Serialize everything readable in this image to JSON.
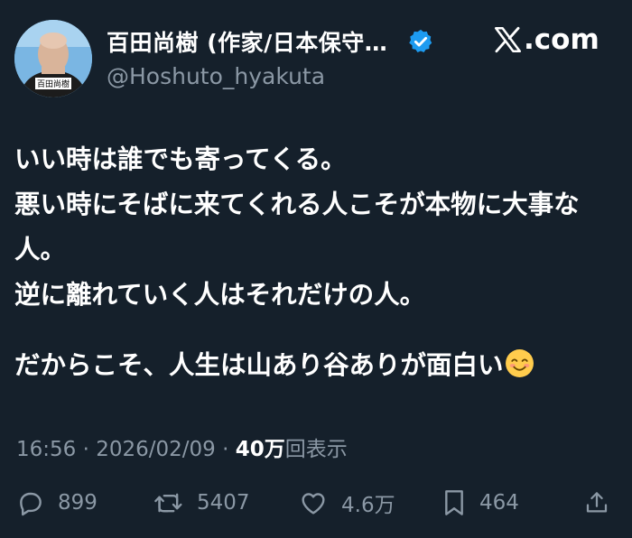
{
  "author": {
    "display_name": "百田尚樹 (作家/日本保守…",
    "handle": "@Hoshuto_hyakuta",
    "avatar_caption": "百田尚樹",
    "verified": true
  },
  "brand": {
    "icon": "x-logo-icon",
    "suffix": ".com"
  },
  "tweet": {
    "lines": [
      "いい時は誰でも寄ってくる。",
      "悪い時にそばに来てくれる人こそが本物に大事な",
      "人。",
      "逆に離れていく人はそれだけの人。",
      "",
      "だからこそ、人生は山あり谷ありが面白い"
    ],
    "emoji": "smiling-face-icon"
  },
  "meta": {
    "time": "16:56",
    "date": "2026/02/09",
    "sep": "·",
    "views_count": "40万",
    "views_label": "回表示"
  },
  "actions": {
    "replies": "899",
    "reposts": "5407",
    "likes": "4.6万",
    "bookmarks": "464"
  },
  "colors": {
    "background": "#15202b",
    "text": "#ffffff",
    "secondary": "#8b98a5",
    "verified": "#1d9bf0"
  }
}
